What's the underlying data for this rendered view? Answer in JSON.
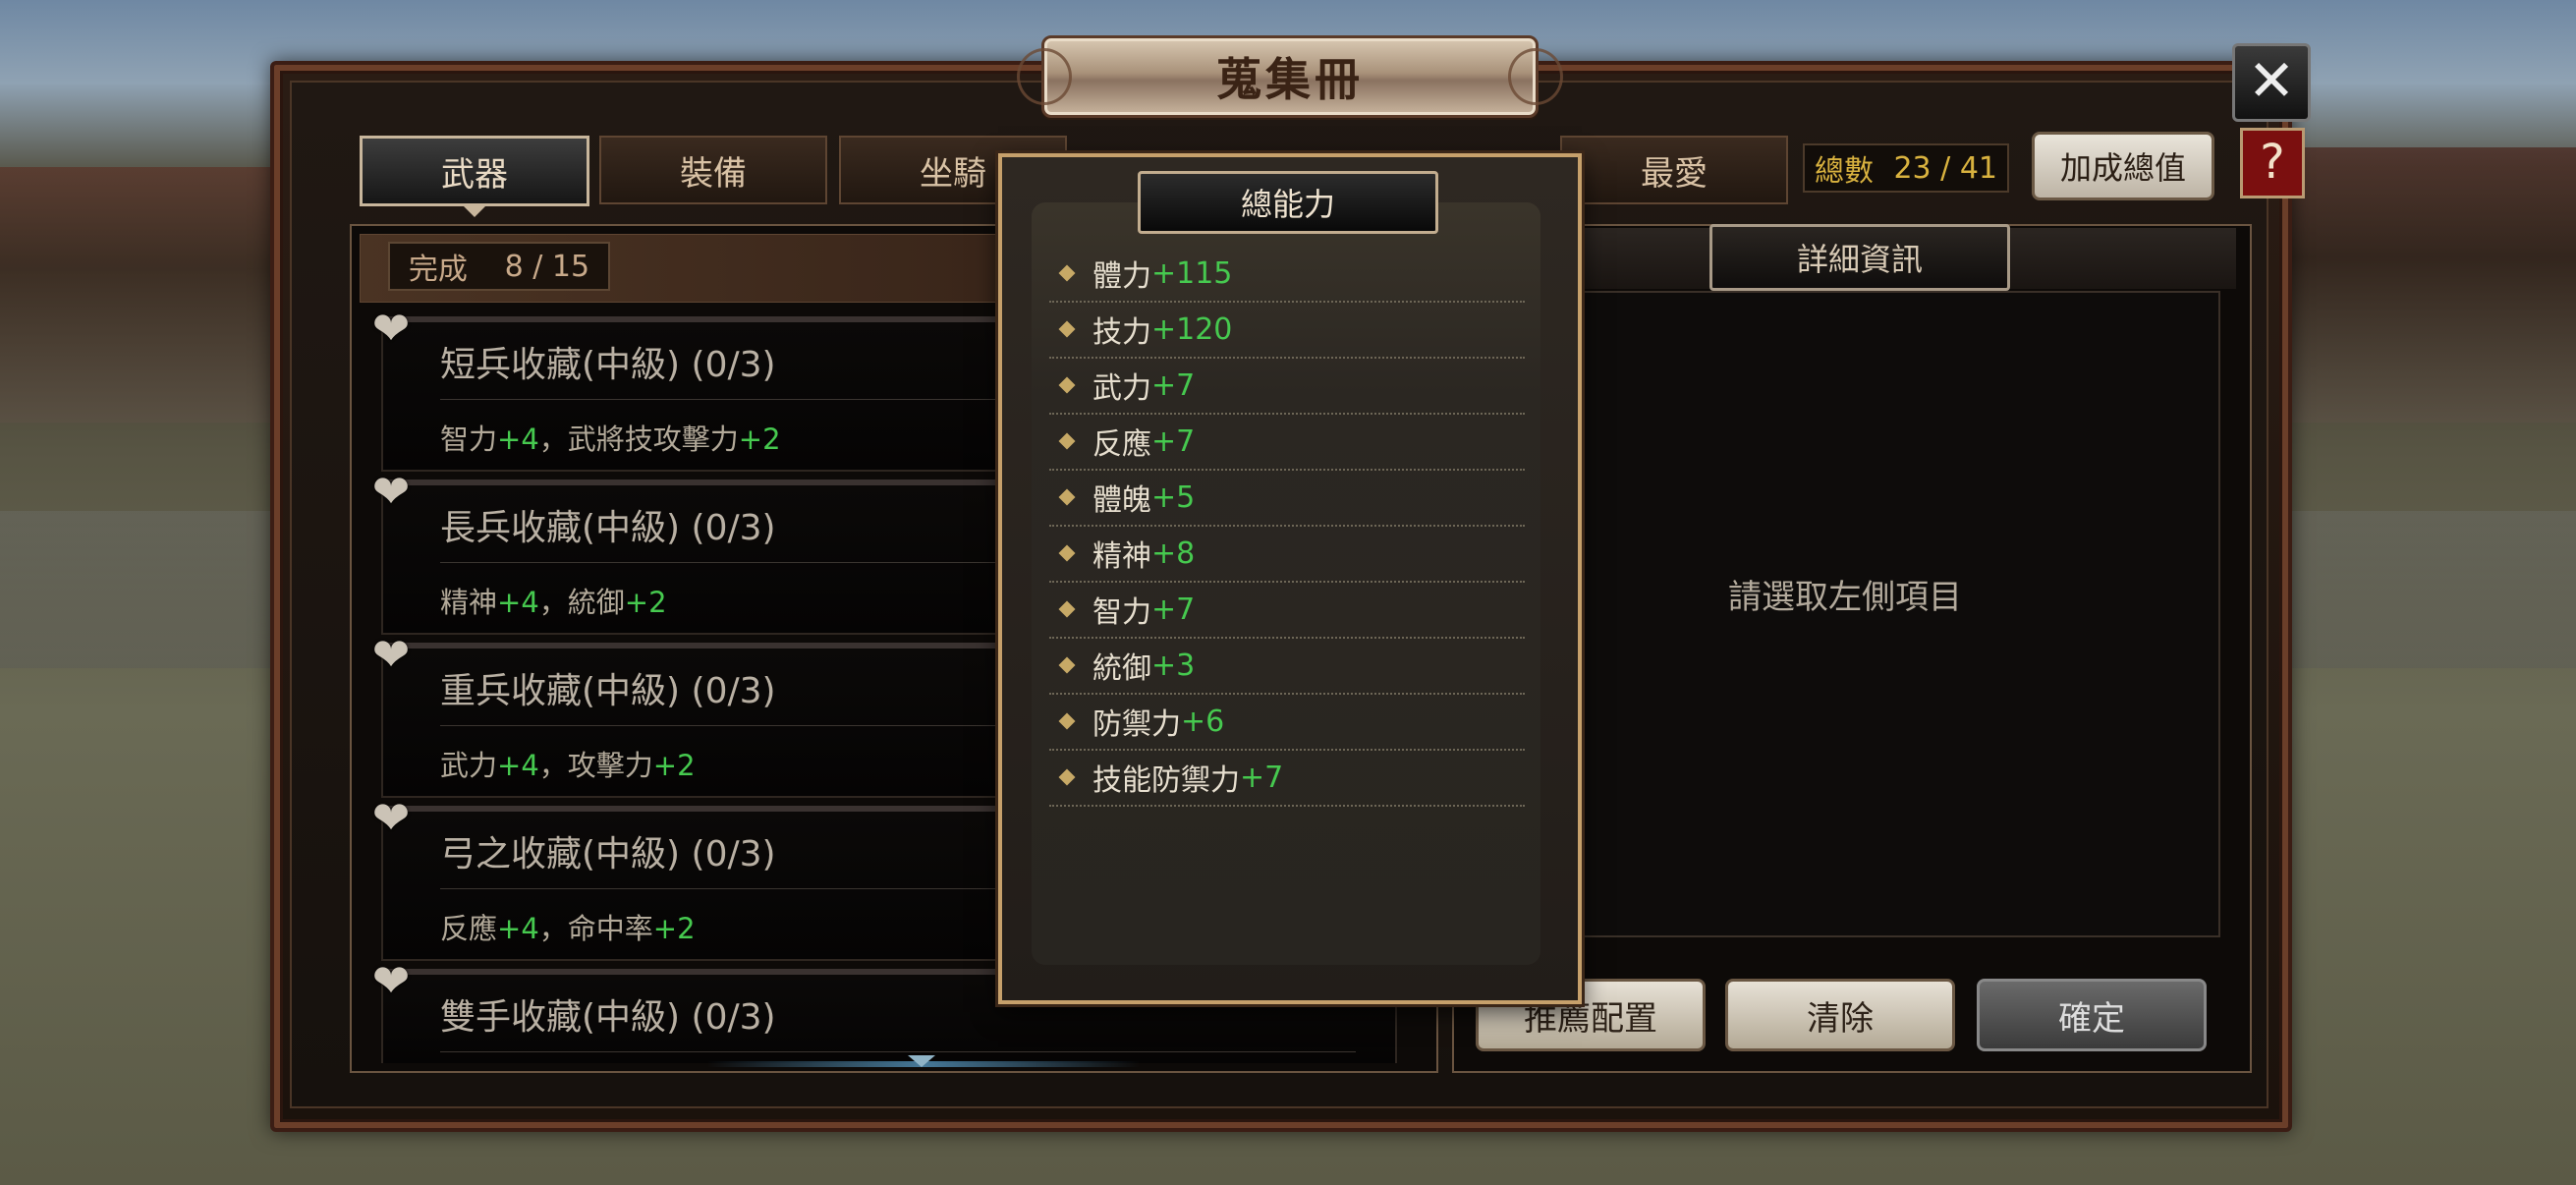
{
  "title": "蒐集冊",
  "tabs": [
    "武器",
    "裝備",
    "坐騎",
    "最愛"
  ],
  "total": {
    "label": "總數",
    "value": "23 / 41"
  },
  "bonus_button": "加成總值",
  "complete": {
    "label": "完成",
    "value": "8 / 15"
  },
  "items": [
    {
      "title": "短兵收藏(中級) (0/3)",
      "bonus": [
        {
          "stat": "智力",
          "val": "+4"
        },
        {
          "stat": "，武將技攻擊力",
          "val": "+2"
        }
      ]
    },
    {
      "title": "長兵收藏(中級) (0/3)",
      "bonus": [
        {
          "stat": "精神",
          "val": "+4"
        },
        {
          "stat": "，統御",
          "val": "+2"
        }
      ]
    },
    {
      "title": "重兵收藏(中級) (0/3)",
      "bonus": [
        {
          "stat": "武力",
          "val": "+4"
        },
        {
          "stat": "，攻擊力",
          "val": "+2"
        }
      ]
    },
    {
      "title": "弓之收藏(中級) (0/3)",
      "bonus": [
        {
          "stat": "反應",
          "val": "+4"
        },
        {
          "stat": "，命中率",
          "val": "+2"
        }
      ]
    },
    {
      "title": "雙手收藏(中級) (0/3)",
      "bonus": []
    }
  ],
  "detail": {
    "title": "詳細資訊",
    "hint": "請選取左側項目"
  },
  "actions": {
    "recommend": "推薦配置",
    "clear": "清除",
    "confirm": "確定"
  },
  "popup": {
    "title": "總能力",
    "stats": [
      {
        "name": "體力",
        "val": "+115"
      },
      {
        "name": "技力",
        "val": "+120"
      },
      {
        "name": "武力",
        "val": "+7"
      },
      {
        "name": "反應",
        "val": "+7"
      },
      {
        "name": "體魄",
        "val": "+5"
      },
      {
        "name": "精神",
        "val": "+8"
      },
      {
        "name": "智力",
        "val": "+7"
      },
      {
        "name": "統御",
        "val": "+3"
      },
      {
        "name": "防禦力",
        "val": "+6"
      },
      {
        "name": "技能防禦力",
        "val": "+7"
      }
    ]
  },
  "icons": {
    "close": "close-icon",
    "help": "help-icon",
    "heart": "heart-icon"
  },
  "colors": {
    "bonus_value": "#46c94f",
    "total_text": "#d9b23f",
    "help_bg": "#7b0f0f"
  }
}
